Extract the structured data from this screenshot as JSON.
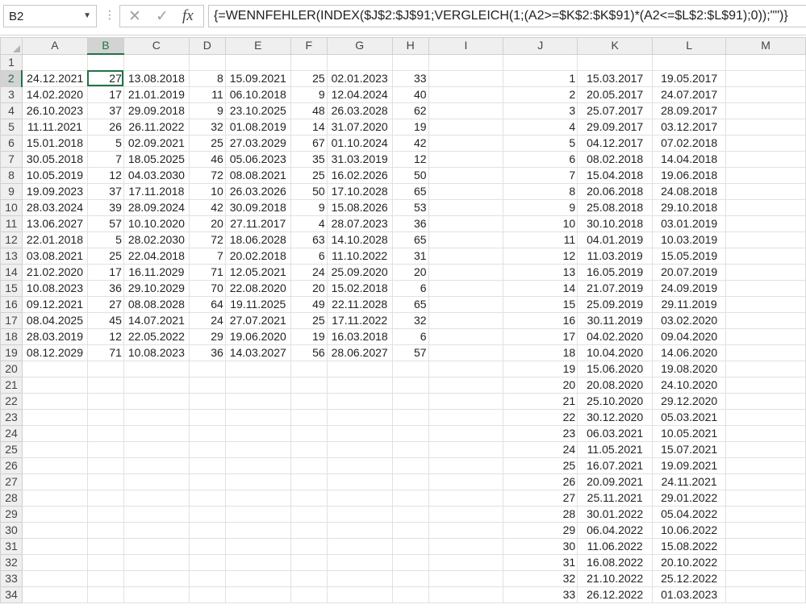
{
  "formula_bar": {
    "name_box": "B2",
    "formula": "{=WENNFEHLER(INDEX($J$2:$J$91;VERGLEICH(1;(A2>=$K$2:$K$91)*(A2<=$L$2:$L$91);0));\"\")}",
    "cancel_symbol": "✕",
    "enter_symbol": "✓",
    "fx_symbol": "fx",
    "separator": "⋮",
    "dropdown_symbol": "▼"
  },
  "sheet": {
    "active_cell": "B2",
    "columns": [
      "A",
      "B",
      "C",
      "D",
      "E",
      "F",
      "G",
      "H",
      "I",
      "J",
      "K",
      "L",
      "M"
    ],
    "row_numbers": [
      1,
      2,
      3,
      4,
      5,
      6,
      7,
      8,
      9,
      10,
      11,
      12,
      13,
      14,
      15,
      16,
      17,
      18,
      19,
      20,
      21,
      22,
      23,
      24,
      25,
      26,
      27,
      28,
      29,
      30,
      31,
      32,
      33,
      34
    ],
    "rows": [
      [
        "",
        "",
        "",
        "",
        "",
        "",
        "",
        "",
        "",
        "",
        "",
        "",
        ""
      ],
      [
        "24.12.2021",
        "27",
        "13.08.2018",
        "8",
        "15.09.2021",
        "25",
        "02.01.2023",
        "33",
        "",
        "1",
        "15.03.2017",
        "19.05.2017",
        ""
      ],
      [
        "14.02.2020",
        "17",
        "21.01.2019",
        "11",
        "06.10.2018",
        "9",
        "12.04.2024",
        "40",
        "",
        "2",
        "20.05.2017",
        "24.07.2017",
        ""
      ],
      [
        "26.10.2023",
        "37",
        "29.09.2018",
        "9",
        "23.10.2025",
        "48",
        "26.03.2028",
        "62",
        "",
        "3",
        "25.07.2017",
        "28.09.2017",
        ""
      ],
      [
        "11.11.2021",
        "26",
        "26.11.2022",
        "32",
        "01.08.2019",
        "14",
        "31.07.2020",
        "19",
        "",
        "4",
        "29.09.2017",
        "03.12.2017",
        ""
      ],
      [
        "15.01.2018",
        "5",
        "02.09.2021",
        "25",
        "27.03.2029",
        "67",
        "01.10.2024",
        "42",
        "",
        "5",
        "04.12.2017",
        "07.02.2018",
        ""
      ],
      [
        "30.05.2018",
        "7",
        "18.05.2025",
        "46",
        "05.06.2023",
        "35",
        "31.03.2019",
        "12",
        "",
        "6",
        "08.02.2018",
        "14.04.2018",
        ""
      ],
      [
        "10.05.2019",
        "12",
        "04.03.2030",
        "72",
        "08.08.2021",
        "25",
        "16.02.2026",
        "50",
        "",
        "7",
        "15.04.2018",
        "19.06.2018",
        ""
      ],
      [
        "19.09.2023",
        "37",
        "17.11.2018",
        "10",
        "26.03.2026",
        "50",
        "17.10.2028",
        "65",
        "",
        "8",
        "20.06.2018",
        "24.08.2018",
        ""
      ],
      [
        "28.03.2024",
        "39",
        "28.09.2024",
        "42",
        "30.09.2018",
        "9",
        "15.08.2026",
        "53",
        "",
        "9",
        "25.08.2018",
        "29.10.2018",
        ""
      ],
      [
        "13.06.2027",
        "57",
        "10.10.2020",
        "20",
        "27.11.2017",
        "4",
        "28.07.2023",
        "36",
        "",
        "10",
        "30.10.2018",
        "03.01.2019",
        ""
      ],
      [
        "22.01.2018",
        "5",
        "28.02.2030",
        "72",
        "18.06.2028",
        "63",
        "14.10.2028",
        "65",
        "",
        "11",
        "04.01.2019",
        "10.03.2019",
        ""
      ],
      [
        "03.08.2021",
        "25",
        "22.04.2018",
        "7",
        "20.02.2018",
        "6",
        "11.10.2022",
        "31",
        "",
        "12",
        "11.03.2019",
        "15.05.2019",
        ""
      ],
      [
        "21.02.2020",
        "17",
        "16.11.2029",
        "71",
        "12.05.2021",
        "24",
        "25.09.2020",
        "20",
        "",
        "13",
        "16.05.2019",
        "20.07.2019",
        ""
      ],
      [
        "10.08.2023",
        "36",
        "29.10.2029",
        "70",
        "22.08.2020",
        "20",
        "15.02.2018",
        "6",
        "",
        "14",
        "21.07.2019",
        "24.09.2019",
        ""
      ],
      [
        "09.12.2021",
        "27",
        "08.08.2028",
        "64",
        "19.11.2025",
        "49",
        "22.11.2028",
        "65",
        "",
        "15",
        "25.09.2019",
        "29.11.2019",
        ""
      ],
      [
        "08.04.2025",
        "45",
        "14.07.2021",
        "24",
        "27.07.2021",
        "25",
        "17.11.2022",
        "32",
        "",
        "16",
        "30.11.2019",
        "03.02.2020",
        ""
      ],
      [
        "28.03.2019",
        "12",
        "22.05.2022",
        "29",
        "19.06.2020",
        "19",
        "16.03.2018",
        "6",
        "",
        "17",
        "04.02.2020",
        "09.04.2020",
        ""
      ],
      [
        "08.12.2029",
        "71",
        "10.08.2023",
        "36",
        "14.03.2027",
        "56",
        "28.06.2027",
        "57",
        "",
        "18",
        "10.04.2020",
        "14.06.2020",
        ""
      ],
      [
        "",
        "",
        "",
        "",
        "",
        "",
        "",
        "",
        "",
        "19",
        "15.06.2020",
        "19.08.2020",
        ""
      ],
      [
        "",
        "",
        "",
        "",
        "",
        "",
        "",
        "",
        "",
        "20",
        "20.08.2020",
        "24.10.2020",
        ""
      ],
      [
        "",
        "",
        "",
        "",
        "",
        "",
        "",
        "",
        "",
        "21",
        "25.10.2020",
        "29.12.2020",
        ""
      ],
      [
        "",
        "",
        "",
        "",
        "",
        "",
        "",
        "",
        "",
        "22",
        "30.12.2020",
        "05.03.2021",
        ""
      ],
      [
        "",
        "",
        "",
        "",
        "",
        "",
        "",
        "",
        "",
        "23",
        "06.03.2021",
        "10.05.2021",
        ""
      ],
      [
        "",
        "",
        "",
        "",
        "",
        "",
        "",
        "",
        "",
        "24",
        "11.05.2021",
        "15.07.2021",
        ""
      ],
      [
        "",
        "",
        "",
        "",
        "",
        "",
        "",
        "",
        "",
        "25",
        "16.07.2021",
        "19.09.2021",
        ""
      ],
      [
        "",
        "",
        "",
        "",
        "",
        "",
        "",
        "",
        "",
        "26",
        "20.09.2021",
        "24.11.2021",
        ""
      ],
      [
        "",
        "",
        "",
        "",
        "",
        "",
        "",
        "",
        "",
        "27",
        "25.11.2021",
        "29.01.2022",
        ""
      ],
      [
        "",
        "",
        "",
        "",
        "",
        "",
        "",
        "",
        "",
        "28",
        "30.01.2022",
        "05.04.2022",
        ""
      ],
      [
        "",
        "",
        "",
        "",
        "",
        "",
        "",
        "",
        "",
        "29",
        "06.04.2022",
        "10.06.2022",
        ""
      ],
      [
        "",
        "",
        "",
        "",
        "",
        "",
        "",
        "",
        "",
        "30",
        "11.06.2022",
        "15.08.2022",
        ""
      ],
      [
        "",
        "",
        "",
        "",
        "",
        "",
        "",
        "",
        "",
        "31",
        "16.08.2022",
        "20.10.2022",
        ""
      ],
      [
        "",
        "",
        "",
        "",
        "",
        "",
        "",
        "",
        "",
        "32",
        "21.10.2022",
        "25.12.2022",
        ""
      ],
      [
        "",
        "",
        "",
        "",
        "",
        "",
        "",
        "",
        "",
        "33",
        "26.12.2022",
        "01.03.2023",
        ""
      ]
    ]
  }
}
